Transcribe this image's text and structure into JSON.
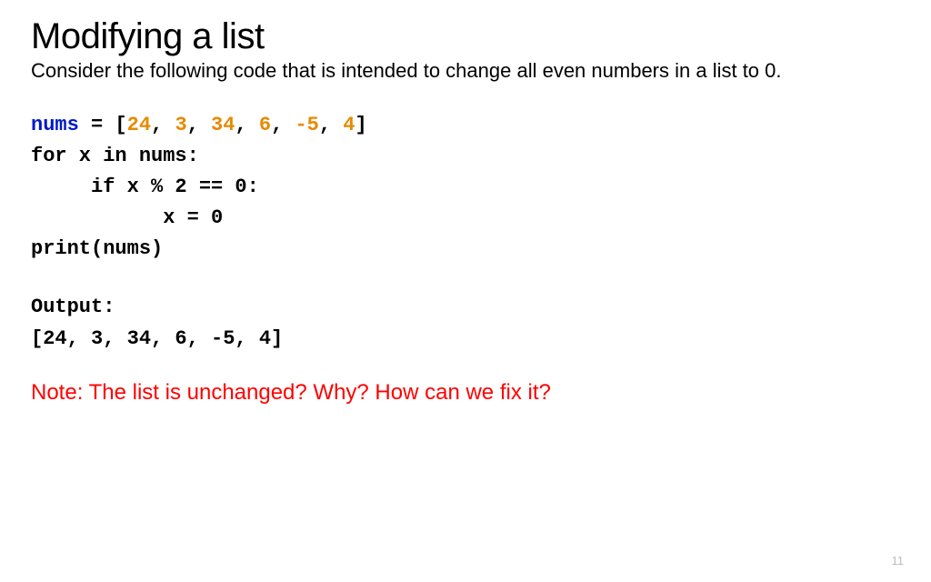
{
  "title": "Modifying a list",
  "subtitle": "Consider the following code that is intended to change all even numbers in a list to 0.",
  "code": {
    "var": "nums",
    "eq": " = [",
    "n0": "24",
    "c0": ", ",
    "n1": "3",
    "c1": ", ",
    "n2": "34",
    "c2": ", ",
    "n3": "6",
    "c3": ", ",
    "n4": "-5",
    "c4": ", ",
    "n5": "4",
    "close": "]",
    "line2": "for x in nums:",
    "line3": "     if x % 2 == 0:",
    "line4": "           x = 0",
    "line5": "print(nums)"
  },
  "output_label": "Output:",
  "output_line": "[24, 3, 34, 6, -5, 4]",
  "note": "Note: The list is unchanged? Why? How can we fix it?",
  "pagenum": "11"
}
